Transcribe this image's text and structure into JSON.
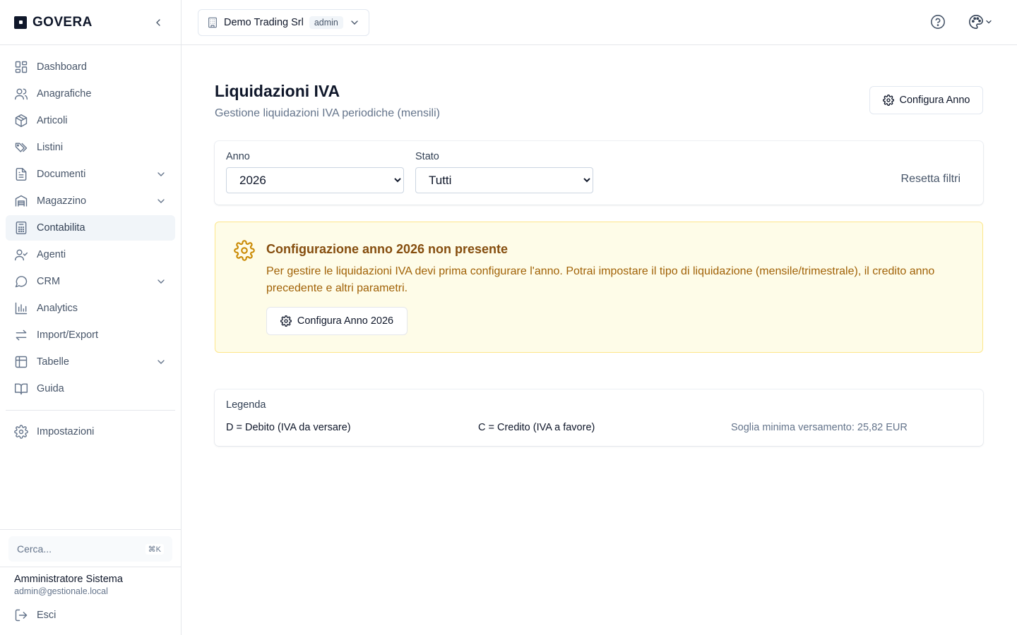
{
  "brand": {
    "name": "GOVERA"
  },
  "sidebar": {
    "items": [
      {
        "label": "Dashboard"
      },
      {
        "label": "Anagrafiche"
      },
      {
        "label": "Articoli"
      },
      {
        "label": "Listini"
      },
      {
        "label": "Documenti"
      },
      {
        "label": "Magazzino"
      },
      {
        "label": "Contabilita"
      },
      {
        "label": "Agenti"
      },
      {
        "label": "CRM"
      },
      {
        "label": "Analytics"
      },
      {
        "label": "Import/Export"
      },
      {
        "label": "Tabelle"
      },
      {
        "label": "Guida"
      }
    ],
    "settings_label": "Impostazioni",
    "search_placeholder": "Cerca...",
    "search_shortcut": "⌘K",
    "user_name": "Amministratore Sistema",
    "user_email": "admin@gestionale.local",
    "logout_label": "Esci"
  },
  "topbar": {
    "company_name": "Demo Trading Srl",
    "role": "admin"
  },
  "page": {
    "title": "Liquidazioni IVA",
    "subtitle": "Gestione liquidazioni IVA periodiche (mensili)",
    "configure_year_label": "Configura Anno"
  },
  "filters": {
    "year_label": "Anno",
    "year_value": "2026",
    "status_label": "Stato",
    "status_value": "Tutti",
    "reset_label": "Resetta filtri"
  },
  "alert": {
    "title": "Configurazione anno 2026 non presente",
    "text": "Per gestire le liquidazioni IVA devi prima configurare l'anno. Potrai impostare il tipo di liquidazione (mensile/trimestrale), il credito anno precedente e altri parametri.",
    "button_label": "Configura Anno 2026"
  },
  "legend": {
    "title": "Legenda",
    "debit": "D = Debito (IVA da versare)",
    "credit": "C = Credito (IVA a favore)",
    "threshold": "Soglia minima versamento: 25,82 EUR"
  },
  "colors": {
    "alert_bg": "#fefce8",
    "alert_border": "#fde68a",
    "alert_title": "#854d0e",
    "alert_text": "#a16207",
    "active_nav_bg": "#f1f5f9"
  }
}
